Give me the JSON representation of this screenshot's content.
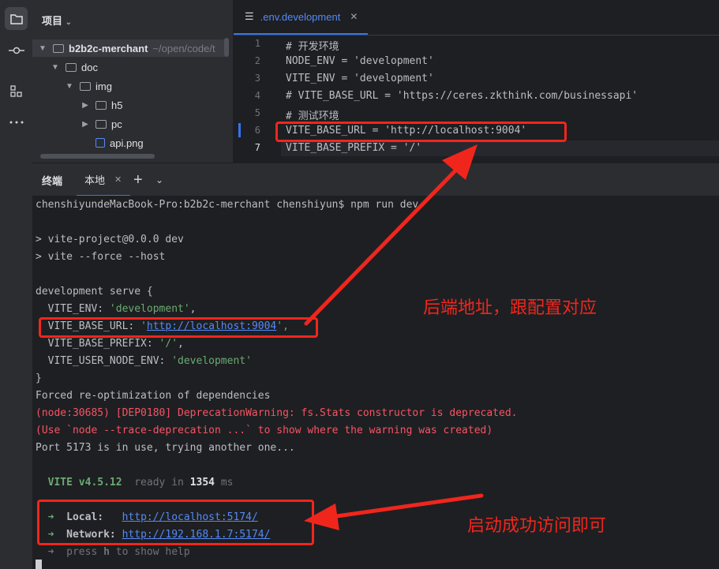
{
  "project_panel": {
    "title": "项目",
    "tree": [
      {
        "label": "b2b2c-merchant",
        "subtitle": "~/open/code/t"
      },
      {
        "label": "doc"
      },
      {
        "label": "img"
      },
      {
        "label": "h5"
      },
      {
        "label": "pc"
      },
      {
        "label": "api.png"
      }
    ]
  },
  "editor": {
    "tab_label": ".env.development",
    "line_numbers": [
      "1",
      "2",
      "3",
      "4",
      "5",
      "6",
      "7"
    ],
    "lines": [
      "# 开发环境",
      "NODE_ENV = 'development'",
      "VITE_ENV = 'development'",
      "# VITE_BASE_URL = 'https://ceres.zkthink.com/businessapi'",
      "# 测试环境",
      "VITE_BASE_URL = 'http://localhost:9004'",
      "VITE_BASE_PREFIX = '/'"
    ]
  },
  "terminal": {
    "tab_terminal": "终端",
    "tab_local": "本地",
    "prompt": "chenshiyundeMacBook-Pro:b2b2c-merchant chenshiyun$ npm run dev",
    "line_script1": "> vite-project@0.0.0 dev",
    "line_script2": "> vite --force --host",
    "serve_open": "development serve {",
    "env_key": "  VITE_ENV: ",
    "env_val": "'development'",
    "base_key": "  VITE_BASE_URL: ",
    "base_quote": "'",
    "base_url": "http://localhost:9004",
    "base_tail": "',",
    "prefix_key": "  VITE_BASE_PREFIX: ",
    "prefix_val": "'/'",
    "node_env_key": "  VITE_USER_NODE_ENV: ",
    "node_env_val": "'development'",
    "serve_close": "}",
    "reopt": "Forced re-optimization of dependencies",
    "warn1": "(node:30685) [DEP0180] DeprecationWarning: fs.Stats constructor is deprecated.",
    "warn2": "(Use `node --trace-deprecation ...` to show where the warning was created)",
    "port_msg": "Port 5173 is in use, trying another one...",
    "vite_version": "VITE v4.5.12",
    "ready_text": "ready in",
    "ready_ms": "1354",
    "ms_unit": "ms",
    "arrow": "➜",
    "local_label": "Local:",
    "local_url": "http://localhost:5174/",
    "network_label": "Network:",
    "network_url": "http://192.168.1.7:5174/",
    "help_prefix": "press ",
    "help_key": "h",
    "help_suffix": " to show help"
  },
  "annotations": {
    "backend_note": "后端地址，跟配置对应",
    "start_note": "启动成功访问即可"
  },
  "colors": {
    "annotation_red": "#f0261d",
    "accent_blue": "#548af7",
    "string_green": "#6aab73",
    "warning_red": "#f75464"
  }
}
